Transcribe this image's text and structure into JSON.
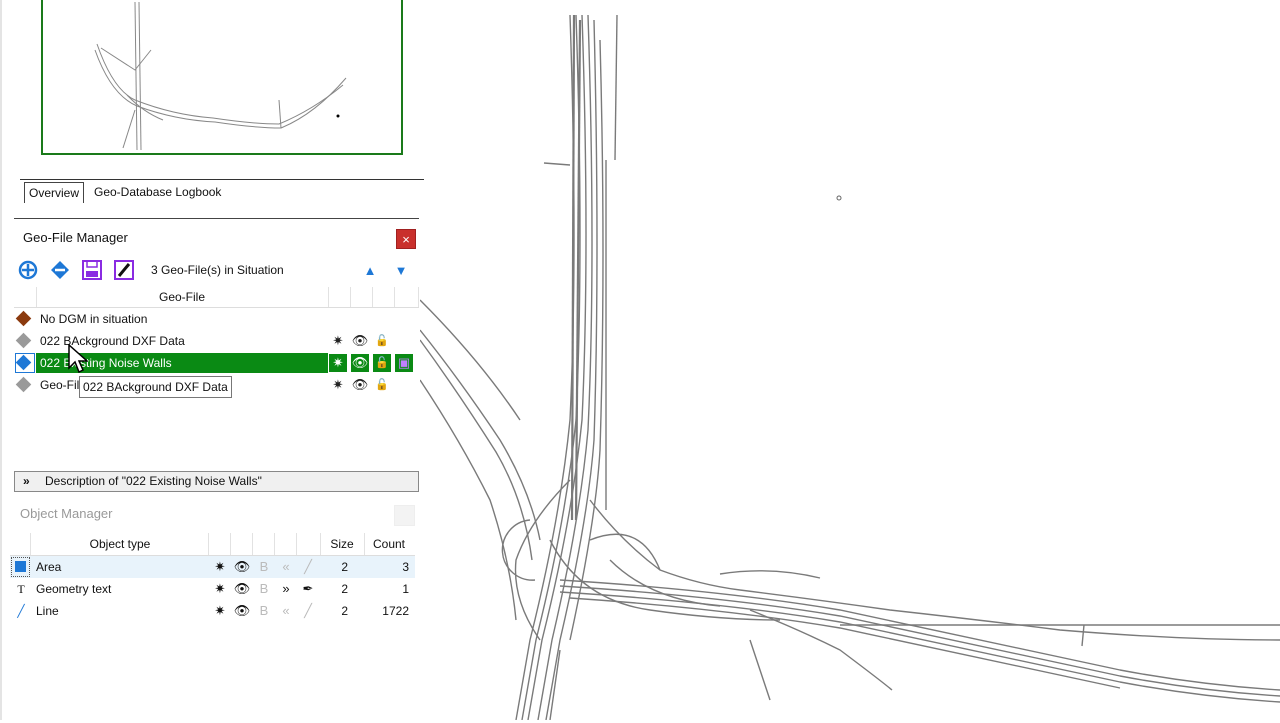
{
  "overview_tabs": [
    "Overview",
    "Geo-Database Logbook"
  ],
  "geo_file_manager": {
    "title": "Geo-File Manager",
    "close_label": "×",
    "count_text": "3 Geo-File(s) in Situation",
    "column_header": "Geo-File",
    "rows": [
      {
        "label": "No DGM in situation",
        "color": "#8b3a0e"
      },
      {
        "label": "022 BAckground DXF Data",
        "color": "#9a9a9a"
      },
      {
        "label": "022 Existing Noise Walls",
        "color": "#1e78d6",
        "selected": true
      },
      {
        "label": "Geo-File",
        "color": "#9a9a9a"
      }
    ],
    "tooltip": "022 BAckground DXF Data",
    "icons": {
      "add": "add-circle-icon",
      "remove": "remove-circle-icon",
      "save": "save-icon",
      "edit": "edit-icon",
      "up": "arrow-up-icon",
      "down": "arrow-down-icon"
    }
  },
  "description_bar": {
    "chevron": "»",
    "text": "Description of \"022 Existing Noise Walls\""
  },
  "object_manager": {
    "title": "Object Manager",
    "headers": {
      "object_type": "Object type",
      "size": "Size",
      "count": "Count"
    },
    "rows": [
      {
        "name": "Area",
        "size": "2",
        "count": "3",
        "icon": "area-square-icon"
      },
      {
        "name": "Geometry text",
        "size": "2",
        "count": "1",
        "icon": "text-icon"
      },
      {
        "name": "Line",
        "size": "2",
        "count": "1722",
        "icon": "line-icon"
      }
    ]
  },
  "colors": {
    "accent_green": "#0a8a14",
    "close_red": "#c9302c",
    "toolbar_blue": "#1e78d6",
    "toolbar_purple": "#8a2be2"
  }
}
